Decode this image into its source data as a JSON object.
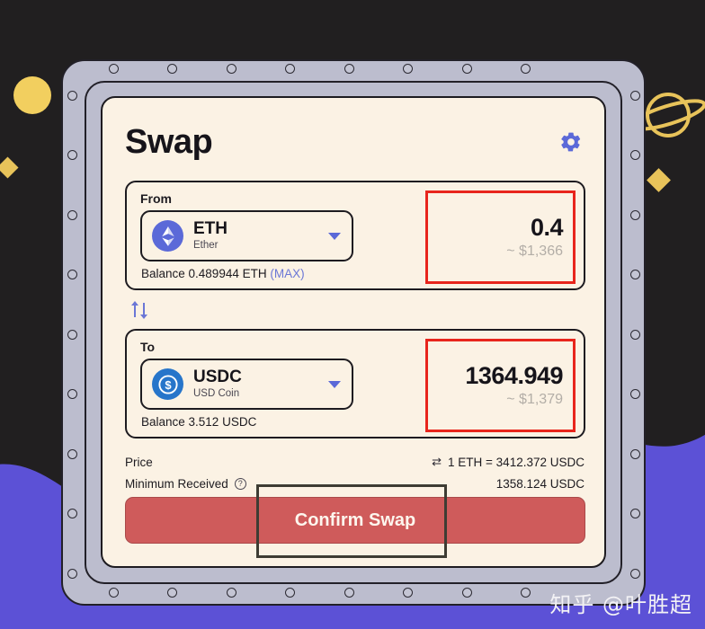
{
  "app": {
    "title": "Swap",
    "settings_icon": "gear-icon"
  },
  "from_panel": {
    "label": "From",
    "token": {
      "symbol": "ETH",
      "name": "Ether",
      "icon": "ethereum-icon",
      "color": "#5b69d8"
    },
    "balance_text": "Balance 0.489944 ETH",
    "max_label": "(MAX)",
    "amount": "0.4",
    "amount_usd": "~ $1,366",
    "highlight_color": "#e8251c"
  },
  "switch_button": {
    "icon": "swap-arrows-icon"
  },
  "to_panel": {
    "label": "To",
    "token": {
      "symbol": "USDC",
      "name": "USD Coin",
      "icon": "usdc-icon",
      "color": "#2775ca"
    },
    "balance_text": "Balance 3.512 USDC",
    "amount": "1364.949",
    "amount_usd": "~ $1,379",
    "highlight_color": "#e8251c"
  },
  "details": {
    "price_label": "Price",
    "price_value": "1 ETH = 3412.372 USDC",
    "price_swap_icon": "swap-rate-icon",
    "minimum_label": "Minimum Received",
    "minimum_help_icon": "question-mark-icon",
    "minimum_value": "1358.124 USDC"
  },
  "confirm": {
    "label": "Confirm Swap",
    "color": "#cf5b5b"
  },
  "decorations": {
    "planet": "saturn-icon",
    "circle": "yellow-circle",
    "diamond_left": "yellow-diamond",
    "diamond_right": "yellow-diamond",
    "wave_color": "#5c51d6",
    "frame_color": "#bcbdce",
    "background_color": "#211f20"
  },
  "watermark": {
    "text": "知乎 @叶胜超"
  }
}
